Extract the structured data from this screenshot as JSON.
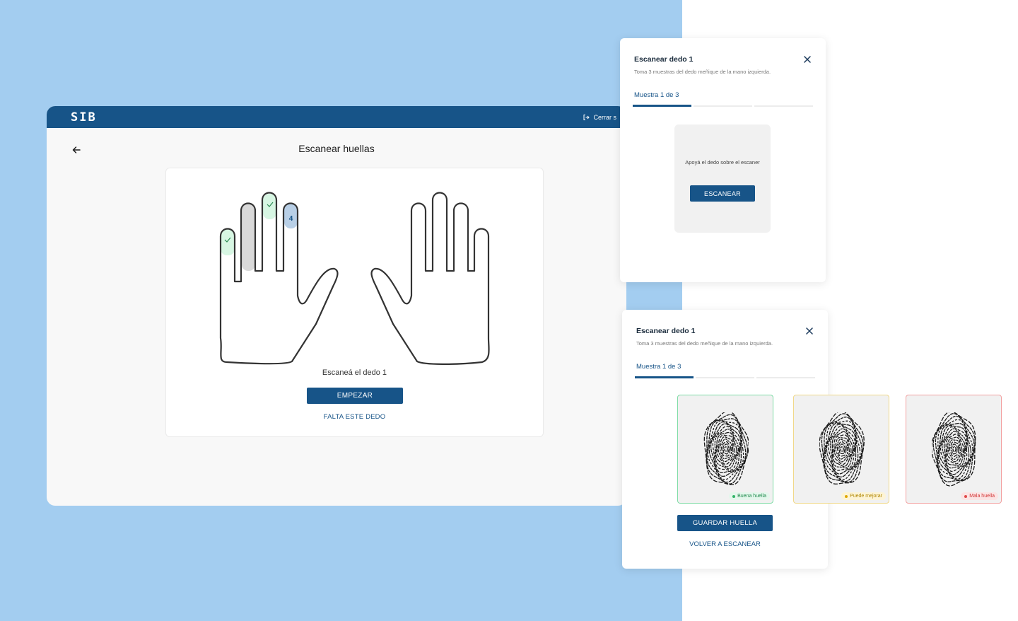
{
  "app": {
    "logo": "SIB",
    "logout_label": "Cerrar s",
    "page_title": "Escanear huellas",
    "instruction": "Escaneá el dedo 1",
    "start_button": "EMPEZAR",
    "missing_finger_link": "FALTA ESTE DEDO",
    "current_finger_number": "4"
  },
  "modal_scan": {
    "title": "Escanear dedo 1",
    "subtitle": "Toma 3 muestras del dedo meñique de la mano izquierda.",
    "tab_label": "Muestra 1 de 3",
    "scanner_text": "Apoyá el dedo sobre el escaner",
    "scan_button": "ESCANEAR"
  },
  "modal_result": {
    "title": "Escanear dedo 1",
    "subtitle": "Toma 3 muestras del dedo meñique de la mano izquierda.",
    "tab_label": "Muestra 1 de 3",
    "quality": {
      "good": "Buena huella",
      "medium": "Puede mejorar",
      "bad": "Mala huella"
    },
    "save_button": "GUARDAR HUELLA",
    "rescan_link": "VOLVER A ESCANEAR"
  },
  "colors": {
    "brand": "#175488",
    "background": "#a3cdf0",
    "good": "#2fb466",
    "medium": "#e0a800",
    "bad": "#e04848"
  }
}
